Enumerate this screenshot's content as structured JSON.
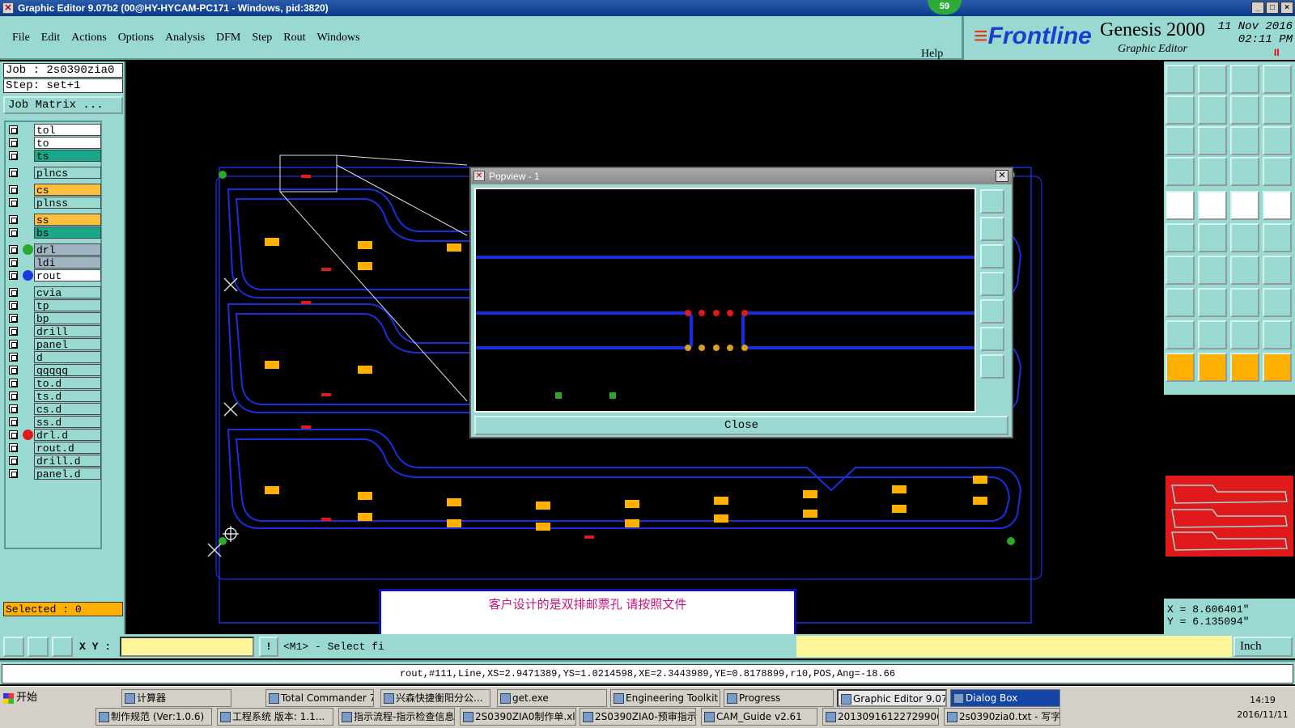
{
  "window": {
    "title": "Graphic Editor 9.07b2 (00@HY-HYCAM-PC171 - Windows, pid:3820)",
    "badge": "59",
    "buttons": [
      "_",
      "□",
      "×"
    ]
  },
  "menu": {
    "items": [
      "File",
      "Edit",
      "Actions",
      "Options",
      "Analysis",
      "DFM",
      "Step",
      "Rout",
      "Windows"
    ],
    "help": "Help"
  },
  "brand": {
    "logo_main": "Frontline",
    "product": "Genesis 2000",
    "subtitle": "Graphic Editor",
    "date": "11 Nov 2016",
    "time": "02:11 PM",
    "pause": "II"
  },
  "job": {
    "job_line": "Job : 2s0390zia0",
    "step_line": "Step: set+1",
    "matrix_button": "Job Matrix ..."
  },
  "layers": [
    {
      "name": "tol",
      "color": "#ffffff",
      "dot": ""
    },
    {
      "name": "to",
      "color": "#ffffff",
      "dot": ""
    },
    {
      "name": "ts",
      "color": "#1aa88a",
      "dot": ""
    },
    {
      "name": "plncs",
      "color": "#9ad8d2",
      "dot": ""
    },
    {
      "name": "cs",
      "color": "#ffc040",
      "dot": ""
    },
    {
      "name": "plnss",
      "color": "#9ad8d2",
      "dot": ""
    },
    {
      "name": "ss",
      "color": "#ffc040",
      "dot": ""
    },
    {
      "name": "bs",
      "color": "#1aa88a",
      "dot": ""
    },
    {
      "name": "drl",
      "color": "#a0b4c4",
      "dot": "#2aa82a"
    },
    {
      "name": "ldi",
      "color": "#a0b4c4",
      "dot": ""
    },
    {
      "name": "rout",
      "color": "#ffffff",
      "dot": "#1a3ae0"
    },
    {
      "name": "cvia",
      "color": "#9ad8d2",
      "dot": ""
    },
    {
      "name": "tp",
      "color": "#9ad8d2",
      "dot": ""
    },
    {
      "name": "bp",
      "color": "#9ad8d2",
      "dot": ""
    },
    {
      "name": "drill",
      "color": "#9ad8d2",
      "dot": ""
    },
    {
      "name": "panel",
      "color": "#9ad8d2",
      "dot": ""
    },
    {
      "name": "d",
      "color": "#9ad8d2",
      "dot": ""
    },
    {
      "name": "qqqqq",
      "color": "#9ad8d2",
      "dot": ""
    },
    {
      "name": "to.d",
      "color": "#9ad8d2",
      "dot": ""
    },
    {
      "name": "ts.d",
      "color": "#9ad8d2",
      "dot": ""
    },
    {
      "name": "cs.d",
      "color": "#9ad8d2",
      "dot": ""
    },
    {
      "name": "ss.d",
      "color": "#9ad8d2",
      "dot": ""
    },
    {
      "name": "drl.d",
      "color": "#9ad8d2",
      "dot": "#e01a1a"
    },
    {
      "name": "rout.d",
      "color": "#9ad8d2",
      "dot": ""
    },
    {
      "name": "drill.d",
      "color": "#9ad8d2",
      "dot": ""
    },
    {
      "name": "panel.d",
      "color": "#9ad8d2",
      "dot": ""
    }
  ],
  "selected": "Selected : 0",
  "popview": {
    "title": "Popview - 1",
    "close_label": "Close"
  },
  "note": {
    "text": "客户设计的是双排邮票孔 请按照文件"
  },
  "coords": {
    "x": "X = 8.606401\"",
    "y": "Y = 6.135094\""
  },
  "command": {
    "xy_label": "X Y :",
    "xy_value": "",
    "bang": "!",
    "prompt": "<M1> - Select fi",
    "unit": "Inch"
  },
  "status": "rout,#111,Line,XS=2.9471389,YS=1.0214598,XE=2.3443989,YE=0.8178899,r10,POS,Ang=-18.66",
  "taskbar": {
    "start": "开始",
    "row1": [
      "计算器",
      "Total Commander 7.0...",
      "兴森快捷衡阳分公...",
      "get.exe",
      "Engineering Toolkit 9....",
      "Progress",
      "Graphic Editor 9.07...",
      "Dialog Box"
    ],
    "row2": [
      "制作规范 (Ver:1.0.6)",
      "工程系统  版本: 1.1...",
      "指示流程-指示检查信息",
      "2S0390ZIA0制作单.xls...",
      "2S0390ZIA0-预审指示...",
      "CAM_Guide v2.61",
      "20130916122729906.r...",
      "2s0390zia0.txt - 写字板"
    ],
    "time": "14:19",
    "date": "2016/11/11"
  },
  "colors": {
    "panel_bg": "#9ad8d2",
    "rout": "#1a2ee0",
    "drill": "#2aa82a",
    "pad": "#ffb000",
    "highlight": "#e01a1a"
  }
}
